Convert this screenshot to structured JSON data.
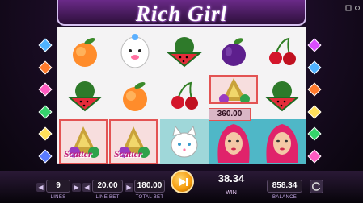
{
  "game": {
    "title": "Rich Girl"
  },
  "colors": {
    "gem_colors": [
      "#4fb2ff",
      "#ff7a2b",
      "#ff5bc1",
      "#35d36b",
      "#ffe05a",
      "#5a7cff",
      "#d94dff"
    ]
  },
  "reels": [
    [
      {
        "symbol": "peach-icon"
      },
      {
        "symbol": "watermelon-icon"
      },
      {
        "symbol": "scatter-gold-icon",
        "label": "Scatter",
        "win": true
      }
    ],
    [
      {
        "symbol": "poodle-dog-icon"
      },
      {
        "symbol": "peach-icon"
      },
      {
        "symbol": "scatter-gold-icon",
        "label": "Scatter",
        "win": true
      }
    ],
    [
      {
        "symbol": "watermelon-icon"
      },
      {
        "symbol": "cherries-icon"
      },
      {
        "symbol": "white-cat-icon"
      }
    ],
    [
      {
        "symbol": "plum-icon"
      },
      {
        "symbol": "scatter-gold-icon",
        "win": true
      },
      {
        "symbol": "rich-girl-icon"
      }
    ],
    [
      {
        "symbol": "cherries-icon"
      },
      {
        "symbol": "watermelon-icon"
      },
      {
        "symbol": "rich-girl-icon"
      }
    ]
  ],
  "win_amount_label": "360.00",
  "controls": {
    "lines_value": "9",
    "lines_label": "LINES",
    "line_bet_value": "20.00",
    "line_bet_label": "LINE BET",
    "total_bet_value": "180.00",
    "total_bet_label": "TOTAL BET",
    "win_value": "38.34",
    "win_label": "WIN",
    "balance_value": "858.34",
    "balance_label": "BALANCE"
  }
}
